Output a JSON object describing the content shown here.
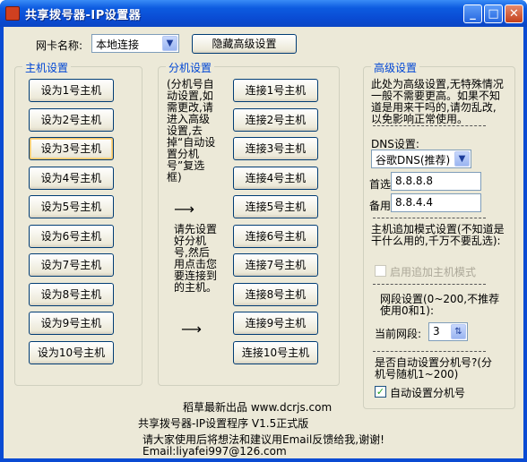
{
  "window": {
    "title": "共享拨号器-IP设置器",
    "minimize": "_",
    "maximize": "□",
    "close": "✕"
  },
  "nic": {
    "label": "网卡名称:",
    "value": "本地连接",
    "hide_button": "隐藏高级设置"
  },
  "host": {
    "title": "主机设置",
    "buttons": [
      "设为1号主机",
      "设为2号主机",
      "设为3号主机",
      "设为4号主机",
      "设为5号主机",
      "设为6号主机",
      "设为7号主机",
      "设为8号主机",
      "设为9号主机",
      "设为10号主机"
    ]
  },
  "branch": {
    "title": "分机设置",
    "note_top": "(分机号自动设置,如需更改,请进入高级设置,去掉“自动设置分机号”复选框)",
    "note_mid": "请先设置好分机号,然后用点击您要连接到的主机。",
    "buttons": [
      "连接1号主机",
      "连接2号主机",
      "连接3号主机",
      "连接4号主机",
      "连接5号主机",
      "连接6号主机",
      "连接7号主机",
      "连接8号主机",
      "连接9号主机",
      "连接10号主机"
    ]
  },
  "advanced": {
    "title": "高级设置",
    "intro": "此处为高级设置,无特殊情况一般不需要更高。如果不知道是用来干吗的,请勿乱改,以免影响正常使用。",
    "dns_label": "DNS设置:",
    "dns_value": "谷歌DNS(推荐)",
    "primary_label": "首选",
    "primary_value": "8.8.8.8",
    "backup_label": "备用",
    "backup_value": "8.8.4.4",
    "append_note": "主机追加模式设置(不知道是干什么用的,千万不要乱选):",
    "append_checkbox": "启用追加主机模式",
    "segment_note": "网段设置(0~200,不推荐使用0和1):",
    "segment_label": "当前网段:",
    "segment_value": "3",
    "auto_note": "是否自动设置分机号?(分机号随机1~200)",
    "auto_checkbox": "自动设置分机号",
    "auto_checked": "✓"
  },
  "footer": {
    "line1": "稻草最新出品 www.dcrjs.com",
    "line2": "共享拨号器-IP设置程序 V1.5正式版",
    "line3": "请大家使用后将想法和建议用Email反馈给我,谢谢!",
    "line4": "Email:liyafei997@126.com"
  }
}
